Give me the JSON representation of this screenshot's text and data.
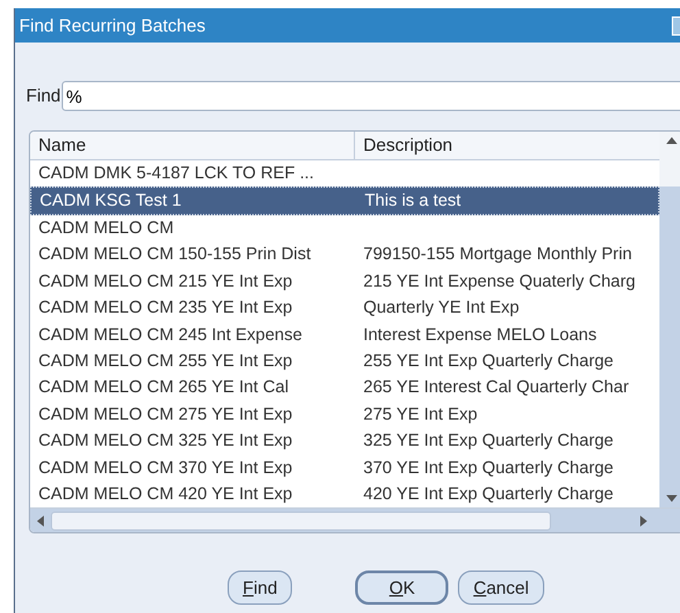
{
  "window": {
    "title": "Find Recurring Batches"
  },
  "find": {
    "label": "Find",
    "value": "%"
  },
  "table": {
    "columns": [
      "Name",
      "Description"
    ],
    "rows": [
      {
        "name": "CADM DMK 5-4187 LCK TO REF ...",
        "description": "",
        "selected": false
      },
      {
        "name": "CADM KSG Test 1",
        "description": "This is a test",
        "selected": true
      },
      {
        "name": "CADM MELO CM",
        "description": "",
        "selected": false
      },
      {
        "name": "CADM MELO CM 150-155 Prin Dist",
        "description": "799150-155 Mortgage Monthly Prin",
        "selected": false
      },
      {
        "name": "CADM MELO CM 215 YE Int Exp",
        "description": "215 YE Int Expense Quaterly Charg",
        "selected": false
      },
      {
        "name": "CADM MELO CM 235 YE Int Exp",
        "description": "Quarterly YE Int Exp",
        "selected": false
      },
      {
        "name": "CADM MELO CM 245 Int Expense",
        "description": "Interest Expense MELO Loans",
        "selected": false
      },
      {
        "name": "CADM MELO CM 255 YE Int Exp",
        "description": "255 YE Int Exp Quarterly Charge",
        "selected": false
      },
      {
        "name": "CADM MELO CM 265 YE Int Cal",
        "description": "265 YE Interest Cal Quarterly Char",
        "selected": false
      },
      {
        "name": "CADM MELO CM 275 YE Int Exp",
        "description": "275 YE Int Exp",
        "selected": false
      },
      {
        "name": "CADM MELO CM 325 YE Int Exp",
        "description": "325 YE Int Exp Quarterly Charge",
        "selected": false
      },
      {
        "name": "CADM MELO CM 370 YE Int Exp",
        "description": "370 YE Int Exp Quarterly Charge",
        "selected": false
      },
      {
        "name": "CADM MELO CM 420 YE Int Exp",
        "description": "420 YE Int Exp Quarterly Charge",
        "selected": false
      }
    ]
  },
  "buttons": [
    {
      "label": "Find",
      "default": false
    },
    {
      "label": "OK",
      "default": true
    },
    {
      "label": "Cancel",
      "default": false
    }
  ]
}
